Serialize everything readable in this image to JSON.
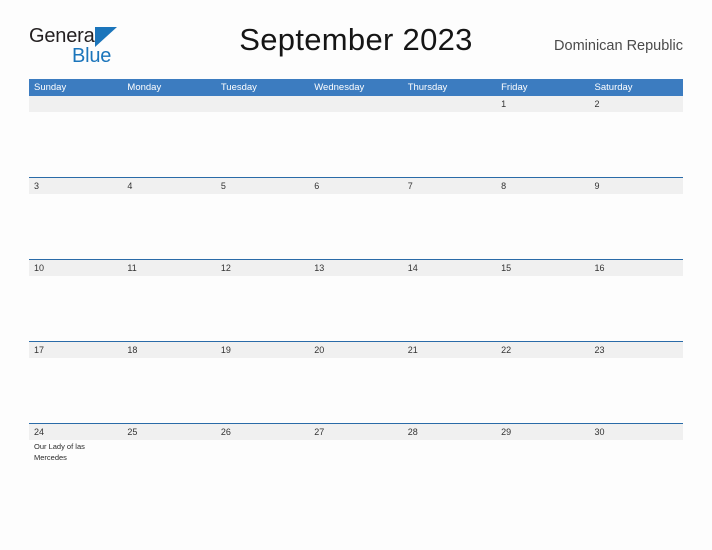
{
  "branding": {
    "name_part1": "General",
    "name_part2": "Blue",
    "triangle_color": "#1b75bb"
  },
  "header": {
    "title": "September 2023",
    "region": "Dominican Republic"
  },
  "theme": {
    "header_blue": "#3c7cc0",
    "band_gray": "#f0f0f0",
    "rule_blue": "#2a6ba8",
    "page_background": "#fdfdfd"
  },
  "calendar": {
    "weekdays": [
      "Sunday",
      "Monday",
      "Tuesday",
      "Wednesday",
      "Thursday",
      "Friday",
      "Saturday"
    ],
    "weeks": [
      [
        {
          "date": "",
          "events": []
        },
        {
          "date": "",
          "events": []
        },
        {
          "date": "",
          "events": []
        },
        {
          "date": "",
          "events": []
        },
        {
          "date": "",
          "events": []
        },
        {
          "date": "1",
          "events": []
        },
        {
          "date": "2",
          "events": []
        }
      ],
      [
        {
          "date": "3",
          "events": []
        },
        {
          "date": "4",
          "events": []
        },
        {
          "date": "5",
          "events": []
        },
        {
          "date": "6",
          "events": []
        },
        {
          "date": "7",
          "events": []
        },
        {
          "date": "8",
          "events": []
        },
        {
          "date": "9",
          "events": []
        }
      ],
      [
        {
          "date": "10",
          "events": []
        },
        {
          "date": "11",
          "events": []
        },
        {
          "date": "12",
          "events": []
        },
        {
          "date": "13",
          "events": []
        },
        {
          "date": "14",
          "events": []
        },
        {
          "date": "15",
          "events": []
        },
        {
          "date": "16",
          "events": []
        }
      ],
      [
        {
          "date": "17",
          "events": []
        },
        {
          "date": "18",
          "events": []
        },
        {
          "date": "19",
          "events": []
        },
        {
          "date": "20",
          "events": []
        },
        {
          "date": "21",
          "events": []
        },
        {
          "date": "22",
          "events": []
        },
        {
          "date": "23",
          "events": []
        }
      ],
      [
        {
          "date": "24",
          "events": [
            "Our Lady of las Mercedes"
          ]
        },
        {
          "date": "25",
          "events": []
        },
        {
          "date": "26",
          "events": []
        },
        {
          "date": "27",
          "events": []
        },
        {
          "date": "28",
          "events": []
        },
        {
          "date": "29",
          "events": []
        },
        {
          "date": "30",
          "events": []
        }
      ]
    ]
  }
}
